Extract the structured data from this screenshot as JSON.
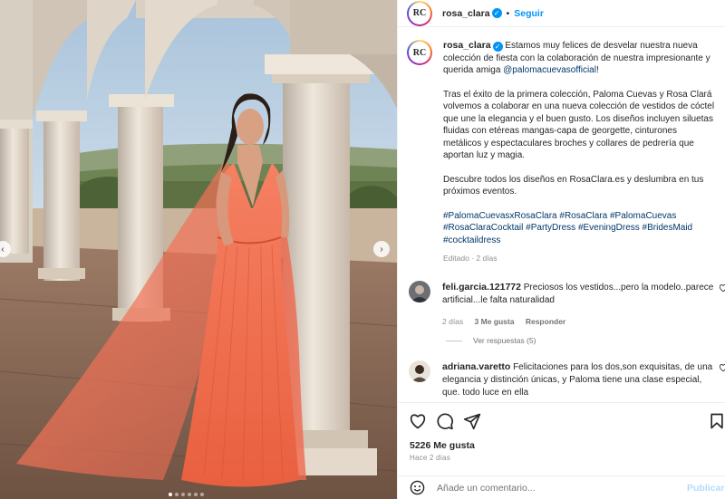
{
  "post": {
    "username": "rosa_clara",
    "avatar_initials": "RC",
    "follow_label": "Seguir",
    "separator": "•"
  },
  "caption": {
    "username": "rosa_clara",
    "p1_text": "Estamos muy felices de desvelar nuestra nueva colección de fiesta con la colaboración de nuestra impresionante y querida amiga ",
    "p1_mention": "@palomacuevasofficial",
    "p1_end": "!",
    "p2": "Tras el éxito de la primera colección, Paloma Cuevas y Rosa Clará volvemos a colaborar en una nueva colección de vestidos de cóctel que une la elegancia y el buen gusto. Los diseños incluyen siluetas fluidas con etéreas mangas-capa de georgette, cinturones metálicos y espectaculares broches y collares de pedrería que aportan luz y magia.",
    "p3": "Descubre todos los diseños en RosaClara.es y deslumbra en tus próximos eventos.",
    "hashtags": "#PalomaCuevasxRosaClara #RosaClara #PalomaCuevas #RosaClaraCocktail #PartyDress #EveningDress #BridesMaid #cocktaildress",
    "meta": "Editado · 2 días"
  },
  "comments": [
    {
      "username": "feli.garcia.121772",
      "text": "Preciosos los vestidos...pero la modelo..parece artificial...le falta naturalidad",
      "time": "2 días",
      "likes": "3 Me gusta",
      "reply": "Responder"
    },
    {
      "username": "adriana.varetto",
      "text": "Felicitaciones para los dos,son exquisitas, de una elegancia y distinción únicas, y Paloma tiene una clase especial, que. todo luce en ella"
    }
  ],
  "view_replies": "Ver respuestas (5)",
  "likes": "5226 Me gusta",
  "time_ago": "Hace 2 días",
  "comment_box": {
    "placeholder": "Añade un comentario...",
    "publish_label": "Publicar"
  },
  "colors": {
    "accent": "#0095f6",
    "dress": "#f0714f"
  },
  "icons": [
    "heart-icon",
    "comment-icon",
    "share-icon",
    "bookmark-icon",
    "emoji-icon",
    "verified-badge-icon",
    "chevron-left-icon",
    "chevron-right-icon"
  ],
  "carousel": {
    "count": 6,
    "active_index": 0
  }
}
